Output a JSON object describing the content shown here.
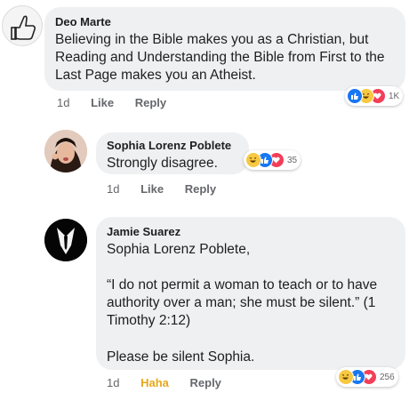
{
  "comments": [
    {
      "author": "Deo Marte",
      "text": "Believing in the Bible makes you as a Christian, but Reading and Understanding the Bible from First to the Last Page makes you an Atheist.",
      "time": "1d",
      "like_label": "Like",
      "reply_label": "Reply",
      "reaction_count": "1K",
      "reactions": [
        "like-icon",
        "haha-icon",
        "love-icon"
      ]
    },
    {
      "author": "Sophia Lorenz Poblete",
      "text": "Strongly disagree.",
      "time": "1d",
      "like_label": "Like",
      "reply_label": "Reply",
      "reaction_count": "35",
      "reactions": [
        "haha-icon",
        "like-icon",
        "love-icon"
      ]
    },
    {
      "author": "Jamie Suarez",
      "text_mention": "Sophia Lorenz Poblete,",
      "text_quote": "“I do not permit a woman to teach or to have authority over a man; she must be silent.” (1 Timothy 2:12)",
      "text_end": "Please be silent Sophia.",
      "time": "1d",
      "like_label": "Haha",
      "reply_label": "Reply",
      "reaction_count": "256",
      "reactions": [
        "haha-icon",
        "like-icon",
        "love-icon"
      ]
    }
  ],
  "colors": {
    "bubble": "#eff0f2",
    "like_blue": "#4b6cb7",
    "haha_yellow": "#e7a81a",
    "action_gray": "#65676b"
  }
}
